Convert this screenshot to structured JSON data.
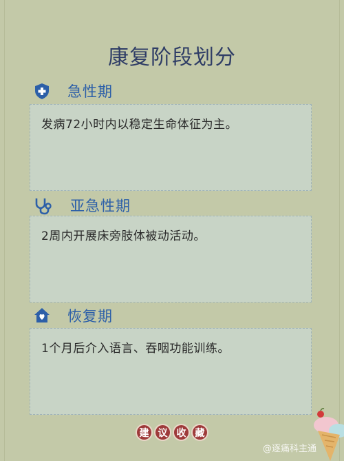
{
  "title": "康复阶段划分",
  "sections": [
    {
      "label": "急性期",
      "icon": "shield-plus-icon",
      "text": "发病72小时内以稳定生命体征为主。"
    },
    {
      "label": "亚急性期",
      "icon": "stethoscope-icon",
      "text": "2周内开展床旁肢体被动活动。"
    },
    {
      "label": "恢复期",
      "icon": "home-heart-icon",
      "text": "1个月后介入语言、吞咽功能训练。"
    }
  ],
  "badges": [
    "建",
    "议",
    "收",
    "藏"
  ],
  "watermark": "@逐痛科主通",
  "colors": {
    "background": "#c3c9a8",
    "title": "#2f3d66",
    "section_label": "#2c5fa8",
    "card": "#c8d4c6",
    "badge": "#9e3a3a"
  }
}
